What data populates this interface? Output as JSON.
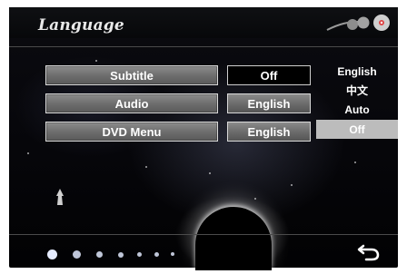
{
  "header": {
    "title": "Language"
  },
  "menu": {
    "items": [
      {
        "label": "Subtitle",
        "value": "Off"
      },
      {
        "label": "Audio",
        "value": "English"
      },
      {
        "label": "DVD Menu",
        "value": "English"
      }
    ]
  },
  "dropdown": {
    "options": [
      "English",
      "中文",
      "Auto",
      "Off"
    ],
    "selected": "Off"
  },
  "footer": {
    "page_count": 7,
    "current_page": 1,
    "back_icon": "return-arrow-icon"
  },
  "colors": {
    "background": "#06060a",
    "button_face": "#7a7a7a",
    "selection": "#bcbcbc",
    "text": "#ffffff"
  }
}
